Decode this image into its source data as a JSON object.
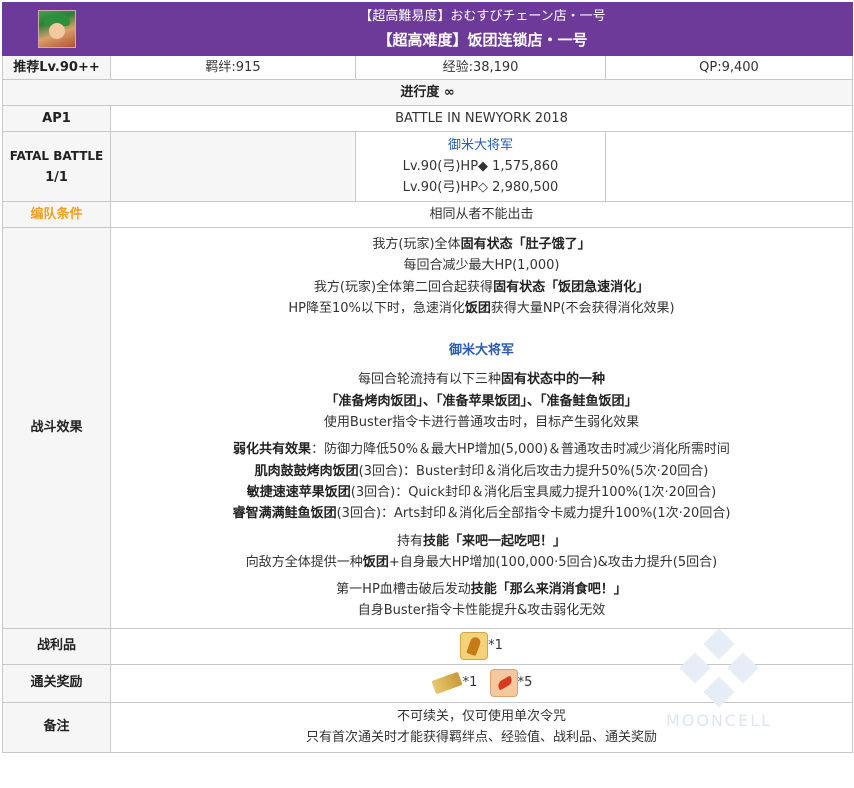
{
  "header": {
    "title_jp": "【超高難易度】おむすびチェーン店・一号",
    "title_cn": "【超高难度】饭团连锁店・一号"
  },
  "stats": {
    "recommend": "推荐Lv.90++",
    "bond": "羁绊:915",
    "exp": "经验:38,190",
    "qp": "QP:9,400"
  },
  "progress": "进行度 ∞",
  "ap": {
    "label": "AP1",
    "battle_name": "BATTLE IN NEWYORK 2018"
  },
  "fatal": {
    "label_line1": "FATAL BATTLE",
    "label_line2": "1/1",
    "enemy_name": "御米大将军",
    "hp1": "Lv.90(弓)HP◆ 1,575,860",
    "hp2": "Lv.90(弓)HP◇ 2,980,500"
  },
  "formation": {
    "label": "编队条件",
    "value": "相同从者不能出击"
  },
  "battle_effects": {
    "label": "战斗效果",
    "l1_a": "我方(玩家)全体",
    "l1_b": "固有状态「肚子饿了」",
    "l2": "每回合减少最大HP(1,000)",
    "l3_a": "我方(玩家)全体第二回合起获得",
    "l3_b": "固有状态「饭团急速消化」",
    "l4_a": "HP降至10%以下时，急速消化",
    "l4_b": "饭团",
    "l4_c": "获得大量NP(不会获得消化效果)",
    "enemy": "御米大将军",
    "l5_a": "每回合轮流持有以下三种",
    "l5_b": "固有状态中的一种",
    "l6": "「准备烤肉饭团」、「准备苹果饭团」、「准备鲑鱼饭团」",
    "l7": "使用Buster指令卡进行普通攻击时，目标产生弱化效果",
    "l8_a": "弱化共有效果",
    "l8_b": "：防御力降低50%＆最大HP增加(5,000)＆普通攻击时减少消化所需时间",
    "l9_a": "肌肉鼓鼓烤肉饭团",
    "l9_b": "(3回合)：Buster封印＆消化后攻击力提升50%(5次·20回合)",
    "l10_a": "敏捷速速苹果饭团",
    "l10_b": "(3回合)：Quick封印＆消化后宝具威力提升100%(1次·20回合)",
    "l11_a": "睿智满满鲑鱼饭团",
    "l11_b": "(3回合)：Arts封印＆消化后全部指令卡威力提升100%(1次·20回合)",
    "l12_a": "持有",
    "l12_b": "技能「来吧一起吃吧！」",
    "l13_a": "向敌方全体提供一种",
    "l13_b": "饭团",
    "l13_c": "+自身最大HP增加(100,000·5回合)&攻击力提升(5回合)",
    "l14_a": "第一HP血槽击破后发动",
    "l14_b": "技能「那么来消消食吧！」",
    "l15": "自身Buster指令卡性能提升&攻击弱化无效"
  },
  "drops": {
    "label": "战利品",
    "count": "*1"
  },
  "rewards": {
    "label": "通关奖励",
    "count1": "*1",
    "count2": "*5"
  },
  "notes": {
    "label": "备注",
    "line1": "不可续关，仅可使用单次令咒",
    "line2": "只有首次通关时才能获得羁绊点、经验值、战利品、通关奖励"
  },
  "watermark": "MOONCELL",
  "colors": {
    "header_bg": "#6e3a9a",
    "label_orange": "#f0a020",
    "enemy_blue": "#2a5bb0"
  }
}
